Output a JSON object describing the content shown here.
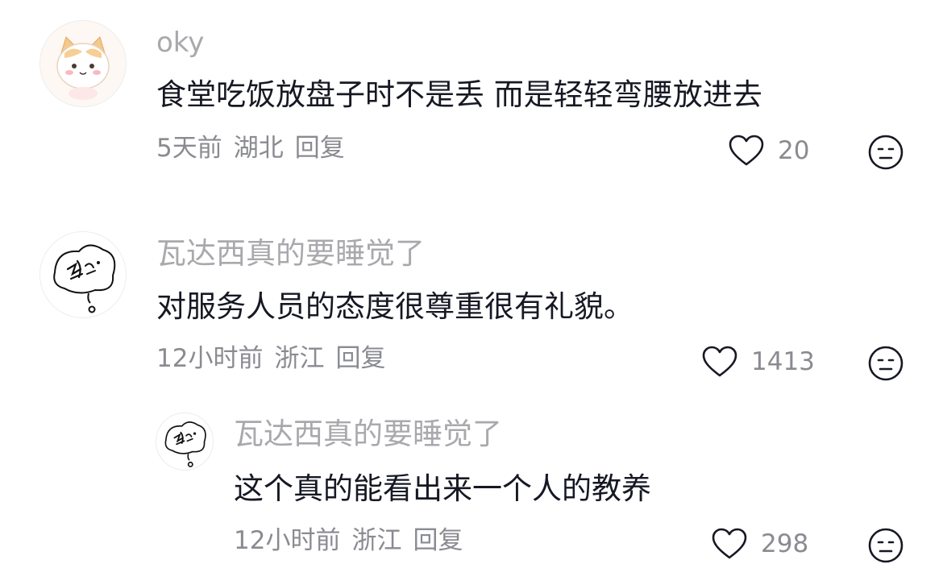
{
  "comments": [
    {
      "username": "oky",
      "text": "食堂吃饭放盘子时不是丢 而是轻轻弯腰放进去",
      "time": "5天前",
      "location": "湖北",
      "reply_label": "回复",
      "likes": "20",
      "avatar_icon": "cat-avatar-icon"
    },
    {
      "username": "瓦达西真的要睡觉了",
      "text": "对服务人员的态度很尊重很有礼貌。",
      "time": "12小时前",
      "location": "浙江",
      "reply_label": "回复",
      "likes": "1413",
      "avatar_icon": "doodle-avatar-icon"
    },
    {
      "username": "瓦达西真的要睡觉了",
      "text": "这个真的能看出来一个人的教养",
      "time": "12小时前",
      "location": "浙江",
      "reply_label": "回复",
      "likes": "298",
      "avatar_icon": "doodle-avatar-icon"
    }
  ],
  "colors": {
    "username": "#a9a9ad",
    "text": "#161823",
    "meta": "#8a8b91"
  }
}
